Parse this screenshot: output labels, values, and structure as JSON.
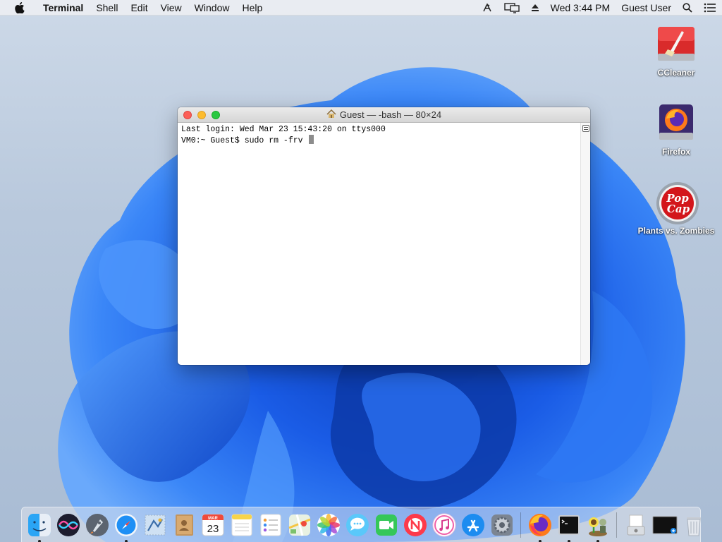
{
  "menubar": {
    "app_name": "Terminal",
    "menus": [
      "Shell",
      "Edit",
      "View",
      "Window",
      "Help"
    ],
    "clock": "Wed 3:44 PM",
    "user": "Guest User"
  },
  "desktop_icons": [
    {
      "label": "CCleaner"
    },
    {
      "label": "Firefox"
    },
    {
      "label": "Plants vs. Zombies"
    }
  ],
  "terminal": {
    "title": "Guest — -bash — 80×24",
    "lines": [
      "Last login: Wed Mar 23 15:43:20 on ttys000",
      "VM0:~ Guest$ sudo rm -frv "
    ]
  },
  "dock": {
    "calendar_month": "MAR",
    "calendar_day": "23",
    "items": [
      {
        "name": "finder",
        "running": true
      },
      {
        "name": "siri",
        "running": false
      },
      {
        "name": "launchpad",
        "running": false
      },
      {
        "name": "safari",
        "running": true
      },
      {
        "name": "mail",
        "running": false
      },
      {
        "name": "contacts",
        "running": false
      },
      {
        "name": "calendar",
        "running": false
      },
      {
        "name": "notes",
        "running": false
      },
      {
        "name": "reminders",
        "running": false
      },
      {
        "name": "maps",
        "running": false
      },
      {
        "name": "photos",
        "running": false
      },
      {
        "name": "messages",
        "running": false
      },
      {
        "name": "facetime",
        "running": false
      },
      {
        "name": "news",
        "running": false
      },
      {
        "name": "itunes",
        "running": false
      },
      {
        "name": "app-store",
        "running": false
      },
      {
        "name": "system-preferences",
        "running": false
      },
      {
        "name": "firefox",
        "running": true
      },
      {
        "name": "terminal",
        "running": true
      },
      {
        "name": "plants-vs-zombies",
        "running": true
      },
      {
        "name": "preview-document",
        "running": false
      },
      {
        "name": "screen-recording",
        "running": false
      },
      {
        "name": "trash",
        "running": false
      }
    ]
  },
  "colors": {
    "wallpaper_blue": "#1f63e8",
    "traffic_close": "#fc5f57",
    "traffic_min": "#fdbc2e",
    "traffic_max": "#28c840"
  }
}
